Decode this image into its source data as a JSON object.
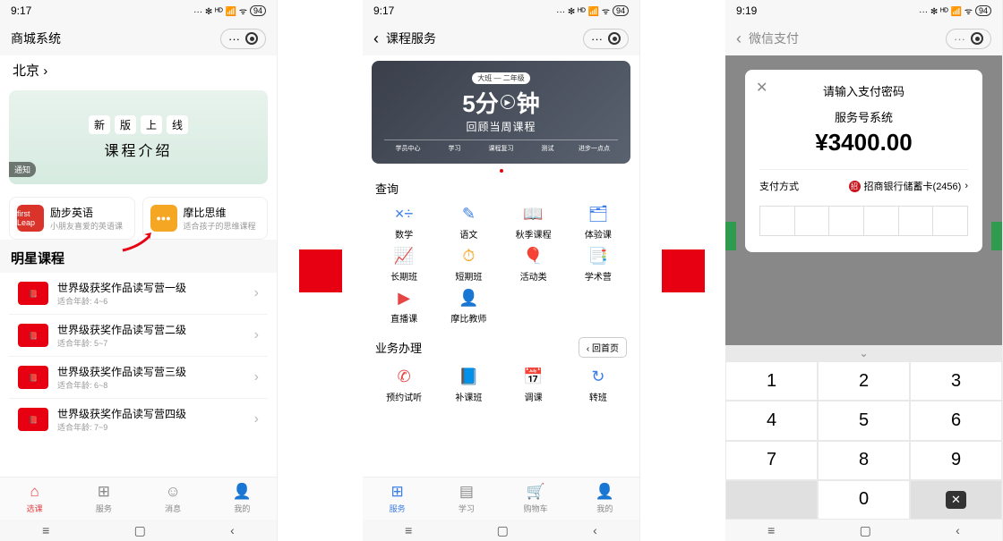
{
  "statusbar": {
    "time1": "9:17",
    "time2": "9:17",
    "time3": "9:19",
    "battery": "94",
    "signal": "⁴ᴳ"
  },
  "screen1": {
    "header_title": "商城系统",
    "location": "北京",
    "banner": {
      "badges": [
        "新",
        "版",
        "上",
        "线"
      ],
      "title": "课程介绍",
      "notice": "通知"
    },
    "cards": [
      {
        "title": "励步英语",
        "sub": "小朋友喜爱的英语课",
        "icon_bg": "#d9332a",
        "icon_text": "first Leap"
      },
      {
        "title": "摩比思维",
        "sub": "适合孩子的思维课程",
        "icon_bg": "#f5a623",
        "icon_text": "●●●"
      }
    ],
    "section_title": "明星课程",
    "courses": [
      {
        "title": "世界级获奖作品读写营一级",
        "sub": "适合年龄: 4~6"
      },
      {
        "title": "世界级获奖作品读写营二级",
        "sub": "适合年龄: 5~7"
      },
      {
        "title": "世界级获奖作品读写营三级",
        "sub": "适合年龄: 6~8"
      },
      {
        "title": "世界级获奖作品读写营四级",
        "sub": "适合年龄: 7~9"
      }
    ],
    "tabs": [
      {
        "label": "选课",
        "icon": "⌂"
      },
      {
        "label": "服务",
        "icon": "⊞"
      },
      {
        "label": "消息",
        "icon": "☺"
      },
      {
        "label": "我的",
        "icon": "👤"
      }
    ]
  },
  "screen2": {
    "header_title": "课程服务",
    "banner": {
      "badge": "大班 — 二年级",
      "big_a": "5分",
      "big_b": "钟",
      "sub": "回顾当周课程",
      "steps": [
        "学员中心",
        "学习",
        "课程复习",
        "测试",
        "进步一点点"
      ]
    },
    "section_query": "查询",
    "query_items": [
      {
        "label": "数学",
        "icon": "×÷",
        "color": "#3b7de8"
      },
      {
        "label": "语文",
        "icon": "✎",
        "color": "#3b7de8"
      },
      {
        "label": "秋季课程",
        "icon": "📖",
        "color": "#3b7de8"
      },
      {
        "label": "体验课",
        "icon": "🗂",
        "color": "#3b7de8"
      },
      {
        "label": "长期班",
        "icon": "📈",
        "color": "#2e9b4f"
      },
      {
        "label": "短期班",
        "icon": "⏱",
        "color": "#f5a623"
      },
      {
        "label": "活动类",
        "icon": "🎈",
        "color": "#3b7de8"
      },
      {
        "label": "学术营",
        "icon": "📑",
        "color": "#2e9b4f"
      },
      {
        "label": "直播课",
        "icon": "▶",
        "color": "#e64545"
      },
      {
        "label": "摩比教师",
        "icon": "👤",
        "color": "#3b7de8"
      }
    ],
    "section_biz": "业务办理",
    "back_home": "回首页",
    "biz_items": [
      {
        "label": "预约试听",
        "icon": "✆",
        "color": "#e64545"
      },
      {
        "label": "补课班",
        "icon": "📘",
        "color": "#3b7de8"
      },
      {
        "label": "调课",
        "icon": "📅",
        "color": "#3b7de8"
      },
      {
        "label": "转班",
        "icon": "↻",
        "color": "#3b7de8"
      }
    ],
    "tabs": [
      {
        "label": "服务",
        "icon": "⊞"
      },
      {
        "label": "学习",
        "icon": "▤"
      },
      {
        "label": "购物车",
        "icon": "🛒"
      },
      {
        "label": "我的",
        "icon": "👤"
      }
    ]
  },
  "screen3": {
    "header_title": "微信支付",
    "modal": {
      "title": "请输入支付密码",
      "merchant": "服务号系统",
      "amount": "¥3400.00",
      "method_label": "支付方式",
      "bank": "招商银行储蓄卡(2456)"
    },
    "keypad": {
      "keys": [
        "1",
        "2",
        "3",
        "4",
        "5",
        "6",
        "7",
        "8",
        "9",
        "",
        "0",
        "⌫"
      ]
    }
  }
}
